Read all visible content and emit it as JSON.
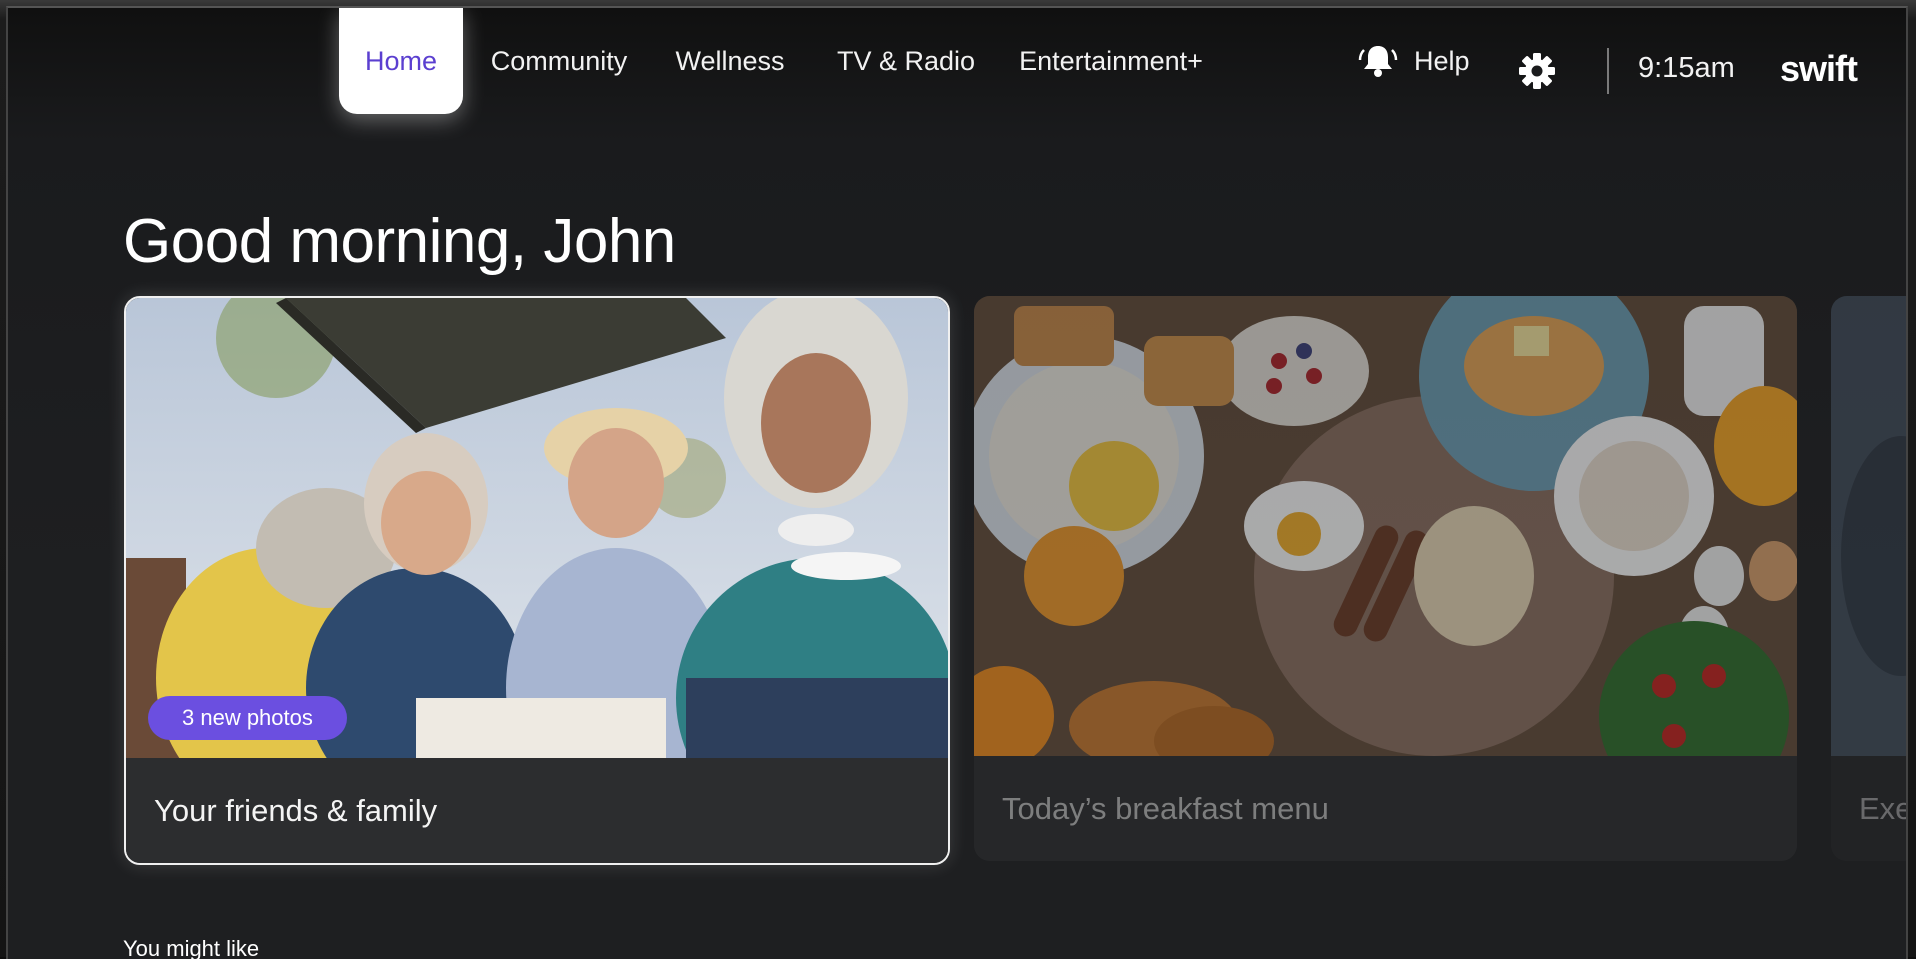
{
  "nav": {
    "tabs": [
      {
        "label": "Home",
        "active": true
      },
      {
        "label": "Community",
        "active": false
      },
      {
        "label": "Wellness",
        "active": false
      },
      {
        "label": "TV & Radio",
        "active": false
      },
      {
        "label": "Entertainment+",
        "active": false
      }
    ],
    "help_label": "Help",
    "help_icon": "bell-icon",
    "settings_icon": "gear-icon",
    "time": "9:15am",
    "logo": "swift"
  },
  "greeting": "Good morning, John",
  "cards": [
    {
      "caption": "Your friends & family",
      "badge": "3 new photos",
      "image": "friends-photo",
      "focused": true
    },
    {
      "caption": "Today’s breakfast menu",
      "image": "breakfast-photo",
      "focused": false
    },
    {
      "caption": "Exe",
      "image": "partial-card-photo",
      "focused": false
    }
  ],
  "sections": {
    "you_might_like": "You might like"
  },
  "colors": {
    "accent": "#6b4fe0",
    "active_tab_text": "#5b3fd0",
    "background": "#1e1f21",
    "card": "#2c2d2f"
  }
}
